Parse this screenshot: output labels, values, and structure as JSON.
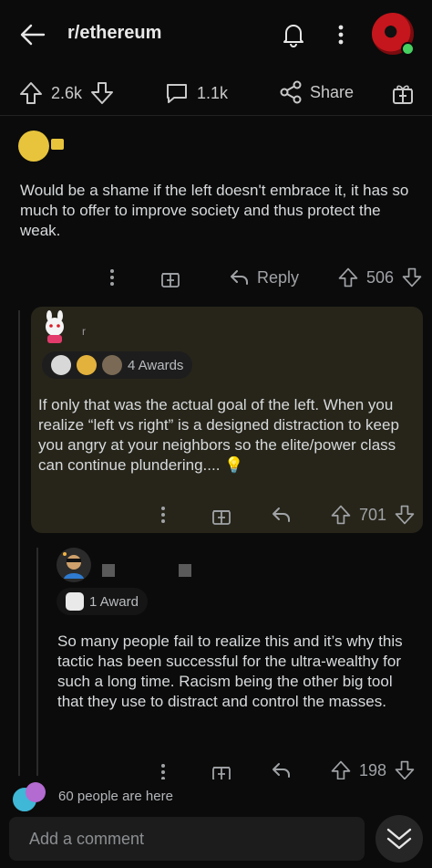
{
  "topbar": {
    "subreddit": "r/ethereum",
    "icons": {
      "back": "back-arrow-icon",
      "notifications": "bell-icon",
      "more": "more-vertical-icon"
    },
    "online_color": "#46d160"
  },
  "post_actions": {
    "upvotes": "2.6k",
    "comments": "1.1k",
    "share_label": "Share"
  },
  "comments": [
    {
      "text": "Would be a shame if the left doesn't embrace it, it has so much to offer to improve society and thus protect the weak.",
      "reply_label": "Reply",
      "score": "506"
    },
    {
      "user_initial": "r",
      "awards_label": "4 Awards",
      "text": "If only that was the actual goal of the left. When you realize “left vs right” is a designed distraction to keep you angry at your neighbors so the elite/power class can continue plundering.... 💡",
      "score": "701",
      "highlight_color": "#27251a"
    },
    {
      "awards_label": "1 Award",
      "text": "So many people fail to realize this and it’s why this tactic has been successful for the ultra-wealthy for such a long time. Racism being the other big tool that they use to distract and control the masses.",
      "score": "198"
    }
  ],
  "footer": {
    "presence": "60 people are here",
    "comment_placeholder": "Add a comment"
  }
}
